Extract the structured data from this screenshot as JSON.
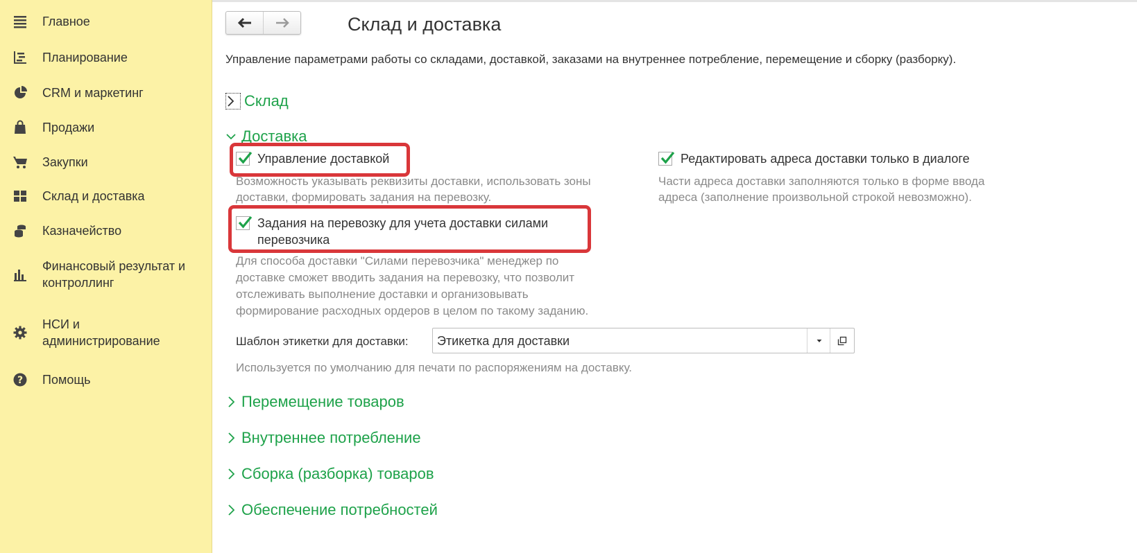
{
  "sidebar": {
    "items": [
      {
        "label": "Главное",
        "icon": "menu-lines-icon"
      },
      {
        "label": "Планирование",
        "icon": "planning-icon"
      },
      {
        "label": "CRM и маркетинг",
        "icon": "pie-chart-icon"
      },
      {
        "label": "Продажи",
        "icon": "shopping-bag-icon"
      },
      {
        "label": "Закупки",
        "icon": "shopping-cart-icon"
      },
      {
        "label": "Склад и доставка",
        "icon": "warehouse-grid-icon"
      },
      {
        "label": "Казначейство",
        "icon": "coins-icon"
      },
      {
        "label": "Финансовый результат и контроллинг",
        "icon": "bar-chart-icon"
      },
      {
        "label": "НСИ и администрирование",
        "icon": "gear-icon"
      },
      {
        "label": "Помощь",
        "icon": "help-icon"
      }
    ]
  },
  "header": {
    "title": "Склад и доставка",
    "description": "Управление параметрами работы со складами, доставкой, заказами на внутреннее потребление, перемещение и сборку (разборку)."
  },
  "sections": {
    "warehouse": "Склад",
    "delivery": "Доставка",
    "transfer": "Перемещение товаров",
    "internal": "Внутреннее потребление",
    "assembly": "Сборка (разборка) товаров",
    "supply": "Обеспечение потребностей"
  },
  "delivery": {
    "manage": {
      "label": "Управление доставкой",
      "checked": true,
      "hint_line1": "Возможность указывать реквизиты доставки, использовать зоны",
      "hint_line2": "доставки, формировать задания на перевозку."
    },
    "edit_address": {
      "label": "Редактировать адреса доставки только в диалоге",
      "checked": true,
      "hint_line1": "Части адреса доставки заполняются только в форме ввода",
      "hint_line2": "адреса (заполнение произвольной строкой невозможно)."
    },
    "carrier_tasks": {
      "label_line1": "Задания на перевозку для учета доставки силами",
      "label_line2": "перевозчика",
      "checked": true,
      "hint_line1": "Для способа доставки \"Силами перевозчика\" менеджер по",
      "hint_line2": "доставке сможет вводить задания на перевозку, что позволит",
      "hint_line3": "отслеживать выполнение доставки и организовывать",
      "hint_line4": "формирование расходных ордеров в целом по такому заданию."
    },
    "label_template": {
      "label": "Шаблон этикетки для доставки:",
      "value": "Этикетка для доставки",
      "hint": "Используется по умолчанию для печати по распоряжениям на доставку."
    }
  },
  "colors": {
    "sidebar_bg": "#fcf2a6",
    "section_green": "#1ea24a",
    "highlight_red": "#d9373a",
    "hint_gray": "#8a8a8a"
  }
}
